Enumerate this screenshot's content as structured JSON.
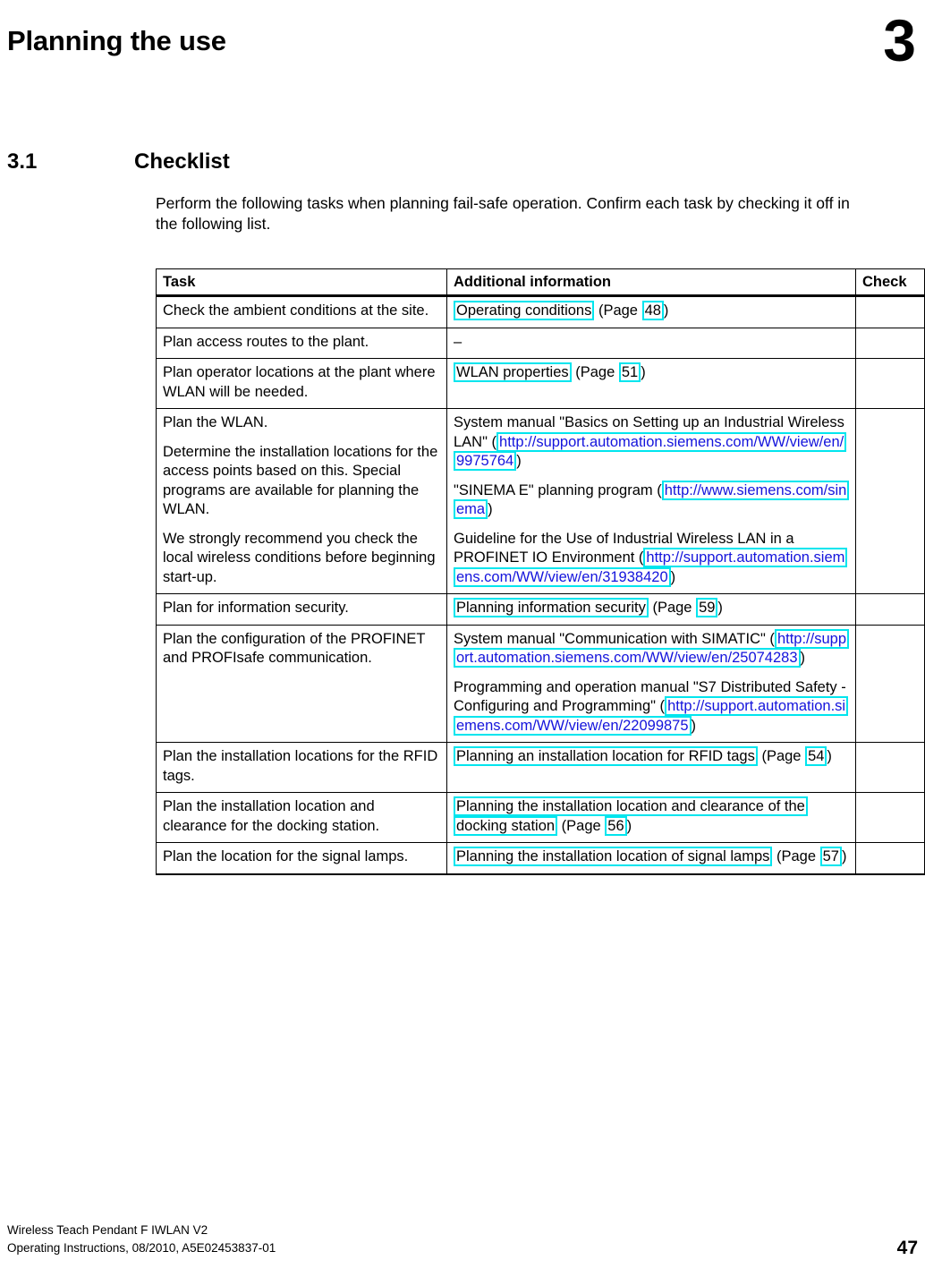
{
  "chapter": {
    "title": "Planning the use",
    "number": "3"
  },
  "section": {
    "number": "3.1",
    "title": "Checklist"
  },
  "intro": "Perform the following tasks when planning fail-safe operation. Confirm each task by checking it off in the following list.",
  "table": {
    "headers": {
      "task": "Task",
      "info": "Additional information",
      "check": "Check"
    },
    "rows": [
      {
        "task": [
          "Check the ambient conditions at the site."
        ],
        "info_parts": [
          [
            {
              "type": "xref",
              "text": "Operating conditions"
            },
            {
              "type": "plain",
              "text": " (Page "
            },
            {
              "type": "pagenum",
              "text": "48"
            },
            {
              "type": "plain",
              "text": ")"
            }
          ]
        ]
      },
      {
        "task": [
          "Plan access routes to the plant."
        ],
        "info_parts": [
          [
            {
              "type": "plain",
              "text": "–"
            }
          ]
        ]
      },
      {
        "task": [
          "Plan operator locations at the plant where WLAN will be needed."
        ],
        "info_parts": [
          [
            {
              "type": "xref",
              "text": "WLAN properties"
            },
            {
              "type": "plain",
              "text": " (Page "
            },
            {
              "type": "pagenum",
              "text": "51"
            },
            {
              "type": "plain",
              "text": ")"
            }
          ]
        ]
      },
      {
        "task": [
          "Plan the WLAN.",
          "Determine the installation locations for the access points based on this. Special programs are available for planning the WLAN.",
          "We strongly recommend you check the local wireless conditions before beginning start-up."
        ],
        "info_parts": [
          [
            {
              "type": "plain",
              "text": "System manual \"Basics on Setting up an Industrial Wireless LAN\" ("
            },
            {
              "type": "weblink",
              "text": "http://support.automation.siemens.com/WW/view/en/9975764"
            },
            {
              "type": "plain",
              "text": ")"
            }
          ],
          [
            {
              "type": "plain",
              "text": "\"SINEMA E\" planning program ("
            },
            {
              "type": "weblink",
              "text": "http://www.siemens.com/sinema"
            },
            {
              "type": "plain",
              "text": ")"
            }
          ],
          [
            {
              "type": "plain",
              "text": "Guideline for the Use of Industrial Wireless LAN in a PROFINET IO Environment ("
            },
            {
              "type": "weblink",
              "text": "http://support.automation.siemens.com/WW/view/en/31938420"
            },
            {
              "type": "plain",
              "text": ")"
            }
          ]
        ]
      },
      {
        "task": [
          "Plan for information security."
        ],
        "info_parts": [
          [
            {
              "type": "xref",
              "text": "Planning information security"
            },
            {
              "type": "plain",
              "text": " (Page "
            },
            {
              "type": "pagenum",
              "text": "59"
            },
            {
              "type": "plain",
              "text": ")"
            }
          ]
        ]
      },
      {
        "task": [
          "Plan the configuration of the PROFINET and PROFIsafe communication."
        ],
        "info_parts": [
          [
            {
              "type": "plain",
              "text": "System manual \"Communication with SIMATIC\" ("
            },
            {
              "type": "weblink",
              "text": "http://support.automation.siemens.com/WW/view/en/25074283"
            },
            {
              "type": "plain",
              "text": ")"
            }
          ],
          [
            {
              "type": "plain",
              "text": "Programming and operation manual \"S7 Distributed Safety - Configuring and Programming\" ("
            },
            {
              "type": "weblink",
              "text": "http://support.automation.siemens.com/WW/view/en/22099875"
            },
            {
              "type": "plain",
              "text": ")"
            }
          ]
        ]
      },
      {
        "task": [
          "Plan the installation locations for the RFID tags."
        ],
        "info_parts": [
          [
            {
              "type": "xref",
              "text": "Planning an installation location for RFID tags"
            },
            {
              "type": "plain",
              "text": " (Page "
            },
            {
              "type": "pagenum",
              "text": "54"
            },
            {
              "type": "plain",
              "text": ")"
            }
          ]
        ]
      },
      {
        "task": [
          "Plan the installation location and clearance for the docking station."
        ],
        "info_parts": [
          [
            {
              "type": "xref",
              "text": "Planning the installation location and clearance of the docking station"
            },
            {
              "type": "plain",
              "text": " (Page "
            },
            {
              "type": "pagenum",
              "text": "56"
            },
            {
              "type": "plain",
              "text": ")"
            }
          ]
        ]
      },
      {
        "task": [
          "Plan the location for the signal lamps."
        ],
        "info_parts": [
          [
            {
              "type": "xref",
              "text": "Planning the installation location of signal lamps"
            },
            {
              "type": "plain",
              "text": " (Page "
            },
            {
              "type": "pagenum",
              "text": "57"
            },
            {
              "type": "plain",
              "text": ")"
            }
          ]
        ]
      }
    ]
  },
  "footer": {
    "line1": "Wireless Teach Pendant F IWLAN V2",
    "line2": "Operating Instructions, 08/2010, A5E02453837-01",
    "page": "47"
  },
  "colors": {
    "link_box": "#00e5ee",
    "link_text": "#1414dc",
    "text": "#000000",
    "background": "#ffffff"
  }
}
